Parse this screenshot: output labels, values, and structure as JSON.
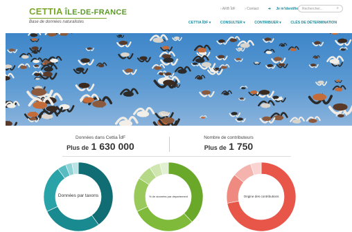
{
  "brand": {
    "name_a": "CETTIA",
    "name_b": "ÎLE-DE-FRANCE",
    "subtitle": "Base de données naturalistes",
    "accent": "#7aa62a"
  },
  "toplinks": {
    "arb": "ARB ÎdF",
    "contact": "Contact",
    "login": "Je m'identifie",
    "search_placeholder": "Rechercher..."
  },
  "nav": {
    "items": [
      "CETTIA ÎDF ▾",
      "CONSULTER ▾",
      "CONTRIBUER ▾",
      "CLÉS DE DÉTERMINATION"
    ],
    "color": "#1b8a9c"
  },
  "stats": {
    "data_label": "Données dans Cettia ÎdF",
    "data_prefix": "Plus de",
    "data_value": "1 630 000",
    "contrib_label": "Nombre de contributeurs",
    "contrib_prefix": "Plus de",
    "contrib_value": "1 750"
  },
  "donuts": [
    {
      "label": "Données par taxons",
      "colors": [
        "#0f6d73",
        "#1a8a91",
        "#2aa3a8",
        "#56bcc1",
        "#8fd3d6",
        "#b9e4e6"
      ],
      "values": [
        40,
        28,
        22,
        4,
        3,
        3
      ]
    },
    {
      "label": "% de données par département",
      "colors": [
        "#6aa82a",
        "#7fba3a",
        "#98c95a",
        "#b5d987",
        "#cfe6b1",
        "#e2f0d2"
      ],
      "values": [
        38,
        30,
        16,
        7,
        5,
        4
      ]
    },
    {
      "label": "Origine des contributions",
      "colors": [
        "#e8564a",
        "#ef8a80",
        "#f4b3ad",
        "#f9d4d0"
      ],
      "values": [
        72,
        14,
        9,
        5
      ]
    }
  ]
}
